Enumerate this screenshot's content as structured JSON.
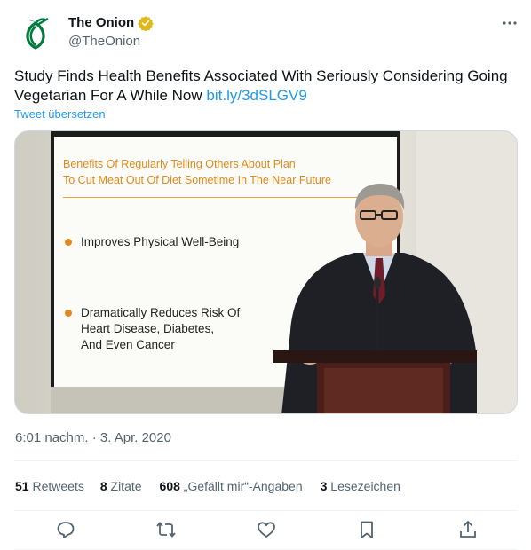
{
  "author": {
    "display_name": "The Onion",
    "handle": "@TheOnion",
    "verified_badge": "gold-verified-icon",
    "avatar_icon": "onion-logo-icon",
    "brand_color": "#007a3d"
  },
  "tweet": {
    "text": "Study Finds Health Benefits Associated With Seriously Considering Going Vegetarian For A While Now",
    "link": "bit.ly/3dSLGV9",
    "translate_label": "Tweet übersetzen",
    "timestamp": "6:01 nachm. · 3. Apr. 2020"
  },
  "media": {
    "slide_title_line1": "Benefits Of Regularly Telling Others About Plan",
    "slide_title_line2": "To Cut Meat Out Of Diet Sometime In The Near Future",
    "bullet1": "Improves Physical Well-Being",
    "bullet2_line1": "Dramatically Reduces Risk Of",
    "bullet2_line2": "Heart Disease, Diabetes,",
    "bullet2_line3": "And Even Cancer"
  },
  "stats": {
    "retweets_count": "51",
    "retweets_label": "Retweets",
    "quotes_count": "8",
    "quotes_label": "Zitate",
    "likes_count": "608",
    "likes_label": "„Gefällt mir“-Angaben",
    "bookmarks_count": "3",
    "bookmarks_label": "Lesezeichen"
  },
  "actions": [
    "reply-icon",
    "retweet-icon",
    "like-icon",
    "bookmark-icon",
    "share-icon"
  ],
  "colors": {
    "link": "#1d9bf0",
    "text": "#0f1419",
    "secondary": "#536471",
    "divider": "#eff3f4",
    "slide_accent": "#e08a1e"
  }
}
